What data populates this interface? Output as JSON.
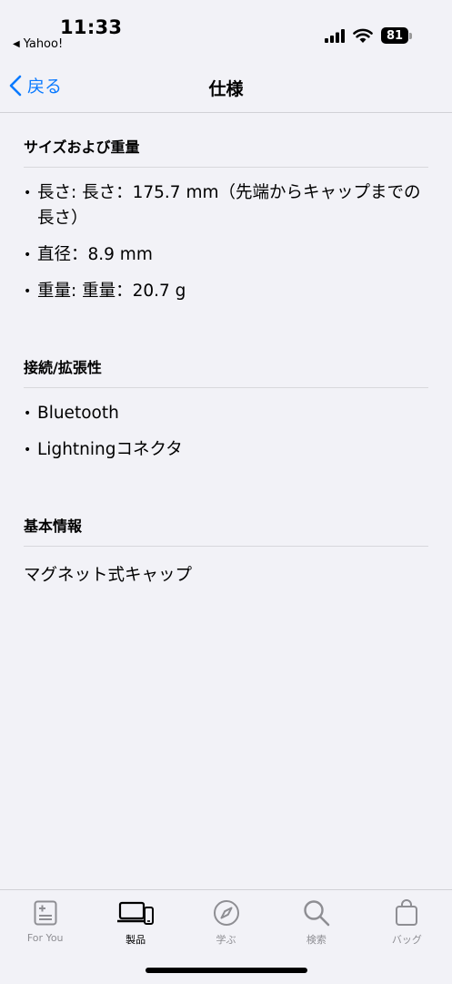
{
  "status_bar": {
    "time": "11:33",
    "back_app_label": "Yahoo!",
    "battery_level": "81"
  },
  "nav": {
    "back_label": "戻る",
    "title": "仕様"
  },
  "sections": [
    {
      "header": "サイズおよび重量",
      "items": [
        "長さ: 長さ：175.7 mm（先端からキャップまでの長さ）",
        "直径：8.9 mm",
        "重量: 重量：20.7 g"
      ]
    },
    {
      "header": "接続/拡張性",
      "items": [
        "Bluetooth",
        "Lightningコネクタ"
      ]
    },
    {
      "header": "基本情報",
      "text": "マグネット式キャップ"
    }
  ],
  "tab_bar": {
    "tabs": [
      {
        "label": "For You",
        "icon": "news-icon",
        "active": false
      },
      {
        "label": "製品",
        "icon": "devices-icon",
        "active": true
      },
      {
        "label": "学ぶ",
        "icon": "compass-icon",
        "active": false
      },
      {
        "label": "検索",
        "icon": "search-icon",
        "active": false
      },
      {
        "label": "バッグ",
        "icon": "bag-icon",
        "active": false
      }
    ]
  },
  "colors": {
    "accent": "#0a7aff",
    "background": "#f2f2f7",
    "inactive_tab": "#8e8e93",
    "divider": "#d8d8dc"
  }
}
